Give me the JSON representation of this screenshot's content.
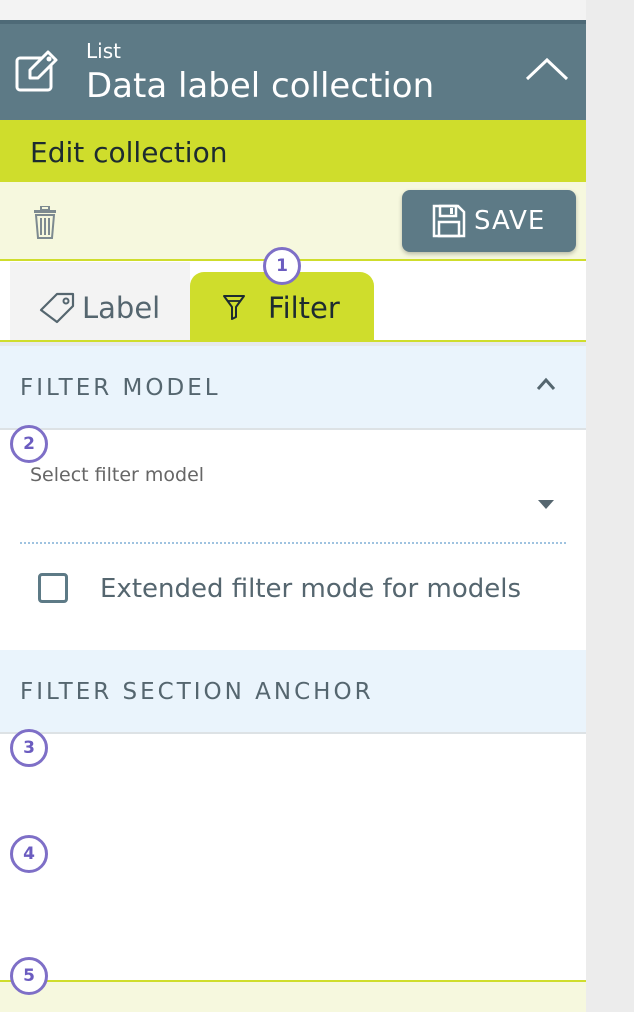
{
  "header": {
    "subtitle": "List",
    "title": "Data label collection"
  },
  "edit_bar": {
    "title": "Edit collection"
  },
  "toolbar": {
    "save_label": "SAVE"
  },
  "tabs": [
    {
      "label": "Label",
      "active": false
    },
    {
      "label": "Filter",
      "active": true
    }
  ],
  "filter_model": {
    "section_title": "FILTER MODEL",
    "select_label": "Select filter model",
    "select_value": "",
    "extended_mode_label": "Extended filter mode for models",
    "extended_mode_checked": false
  },
  "filter_section_anchor": {
    "section_title": "FILTER SECTION ANCHOR"
  },
  "annotations": [
    "1",
    "2",
    "3",
    "4",
    "5"
  ],
  "colors": {
    "header_bg": "#5d7a86",
    "accent_lime": "#cfdd2c",
    "section_bg": "#eaf4fc",
    "badge": "#7e6fc7"
  },
  "icons": [
    "tag-edit-icon",
    "chevron-up-icon",
    "trash-icon",
    "save-icon",
    "tag-icon",
    "funnel-icon",
    "caret-down-icon"
  ]
}
